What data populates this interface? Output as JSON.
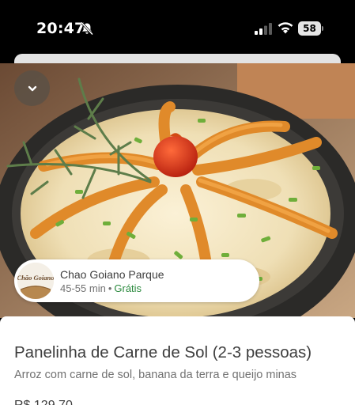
{
  "status_bar": {
    "time": "20:47",
    "battery": "58"
  },
  "icons": {
    "mute": "bell-slash-icon",
    "signal": "cellular-signal-icon",
    "wifi": "wifi-icon",
    "collapse": "chevron-down-icon"
  },
  "restaurant": {
    "name": "Chao Goiano Parque",
    "logo_text": "Chão Goiano",
    "delivery_time": "45-55 min",
    "separator": "•",
    "delivery_fee": "Grátis"
  },
  "dish": {
    "title": "Panelinha de Carne de Sol (2-3 pessoas)",
    "description": "Arroz com carne de sol, banana da terra e queijo minas",
    "price": "R$ 129,70"
  },
  "colors": {
    "free_delivery": "#2b8a3e",
    "text_primary": "#3e3e3e",
    "text_secondary": "#717171"
  }
}
